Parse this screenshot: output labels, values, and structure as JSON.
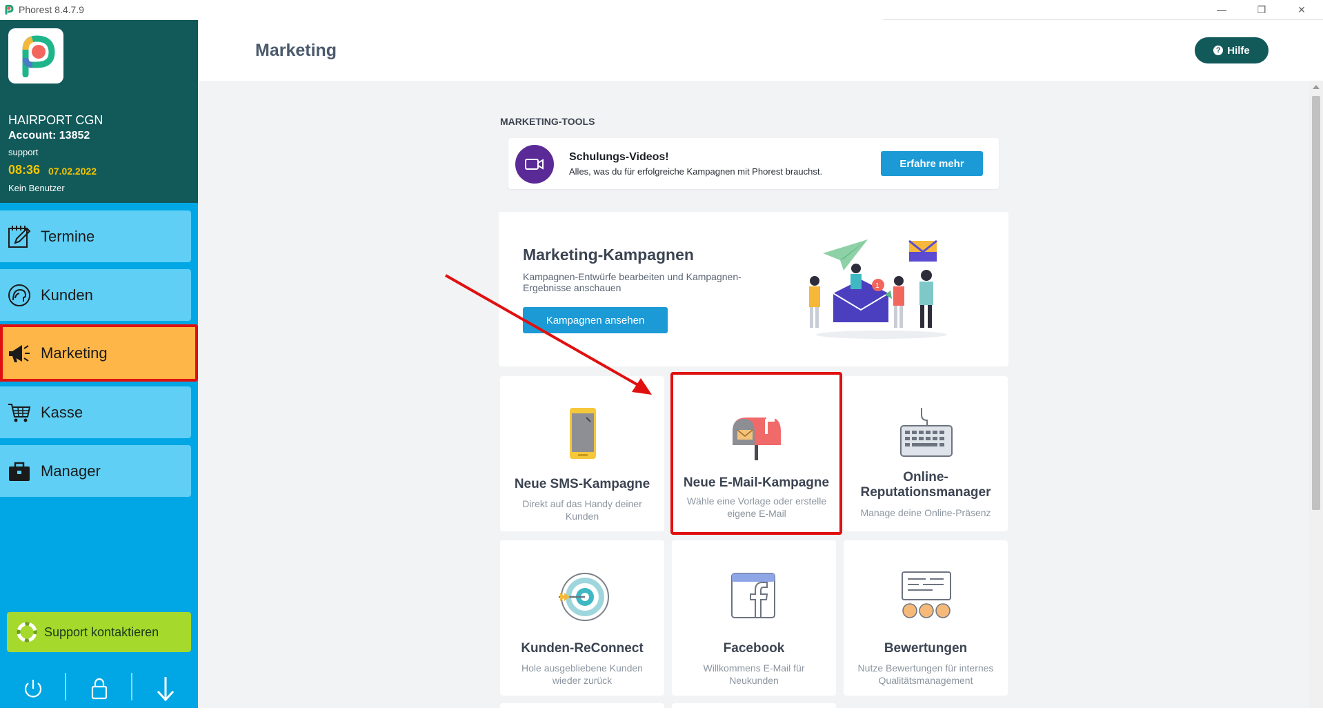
{
  "window": {
    "title": "Phorest 8.4.7.9",
    "minimize_glyph": "—",
    "maximize_glyph": "❐",
    "close_glyph": "✕"
  },
  "account": {
    "salon": "HAIRPORT CGN",
    "account": "Account: 13852",
    "user": "support",
    "time": "08:36",
    "date": "07.02.2022",
    "status": "Kein Benutzer"
  },
  "nav": {
    "items": [
      {
        "label": "Termine",
        "icon": "calendar-edit-icon"
      },
      {
        "label": "Kunden",
        "icon": "customer-head-icon"
      },
      {
        "label": "Marketing",
        "icon": "megaphone-icon",
        "active": true
      },
      {
        "label": "Kasse",
        "icon": "cart-icon"
      },
      {
        "label": "Manager",
        "icon": "briefcase-icon"
      }
    ],
    "support_label": "Support kontaktieren"
  },
  "header": {
    "title": "Marketing",
    "help_label": "Hilfe"
  },
  "tools": {
    "section_label": "MARKETING-TOOLS",
    "training": {
      "title": "Schulungs-Videos!",
      "subtitle": "Alles, was du für erfolgreiche Kampagnen mit Phorest brauchst.",
      "button": "Erfahre mehr"
    },
    "campaigns": {
      "title": "Marketing-Kampagnen",
      "subtitle": "Kampagnen-Entwürfe bearbeiten und Kampagnen-Ergebnisse anschauen",
      "button": "Kampagnen ansehen"
    },
    "tiles": [
      {
        "title": "Neue SMS-Kampagne",
        "subtitle": "Direkt auf das Handy deiner Kunden",
        "icon": "phone-icon"
      },
      {
        "title": "Neue E-Mail-Kampagne",
        "subtitle": "Wähle eine Vorlage oder erstelle eigene E-Mail",
        "icon": "mailbox-icon",
        "highlighted": true
      },
      {
        "title": "Online-Reputationsmanager",
        "title_line1": "Online-",
        "title_line2": "Reputationsmanager",
        "subtitle": "Manage deine Online-Präsenz",
        "icon": "keyboard-icon"
      },
      {
        "title": "Kunden-ReConnect",
        "subtitle": "Hole ausgebliebene Kunden wieder zurück",
        "icon": "target-icon"
      },
      {
        "title": "Facebook",
        "subtitle": "Willkommens E-Mail für Neukunden",
        "icon": "facebook-icon"
      },
      {
        "title": "Bewertungen",
        "subtitle": "Nutze Bewertungen für internes Qualitätsmanagement",
        "icon": "reviews-icon"
      }
    ]
  },
  "colors": {
    "sidebar": "#00a7e4",
    "account_panel": "#12595a",
    "nav_item": "#5fcff5",
    "nav_active": "#ffb648",
    "annotation_red": "#e01010",
    "primary_button": "#1b9ad6",
    "support_green": "#a5d92b"
  }
}
